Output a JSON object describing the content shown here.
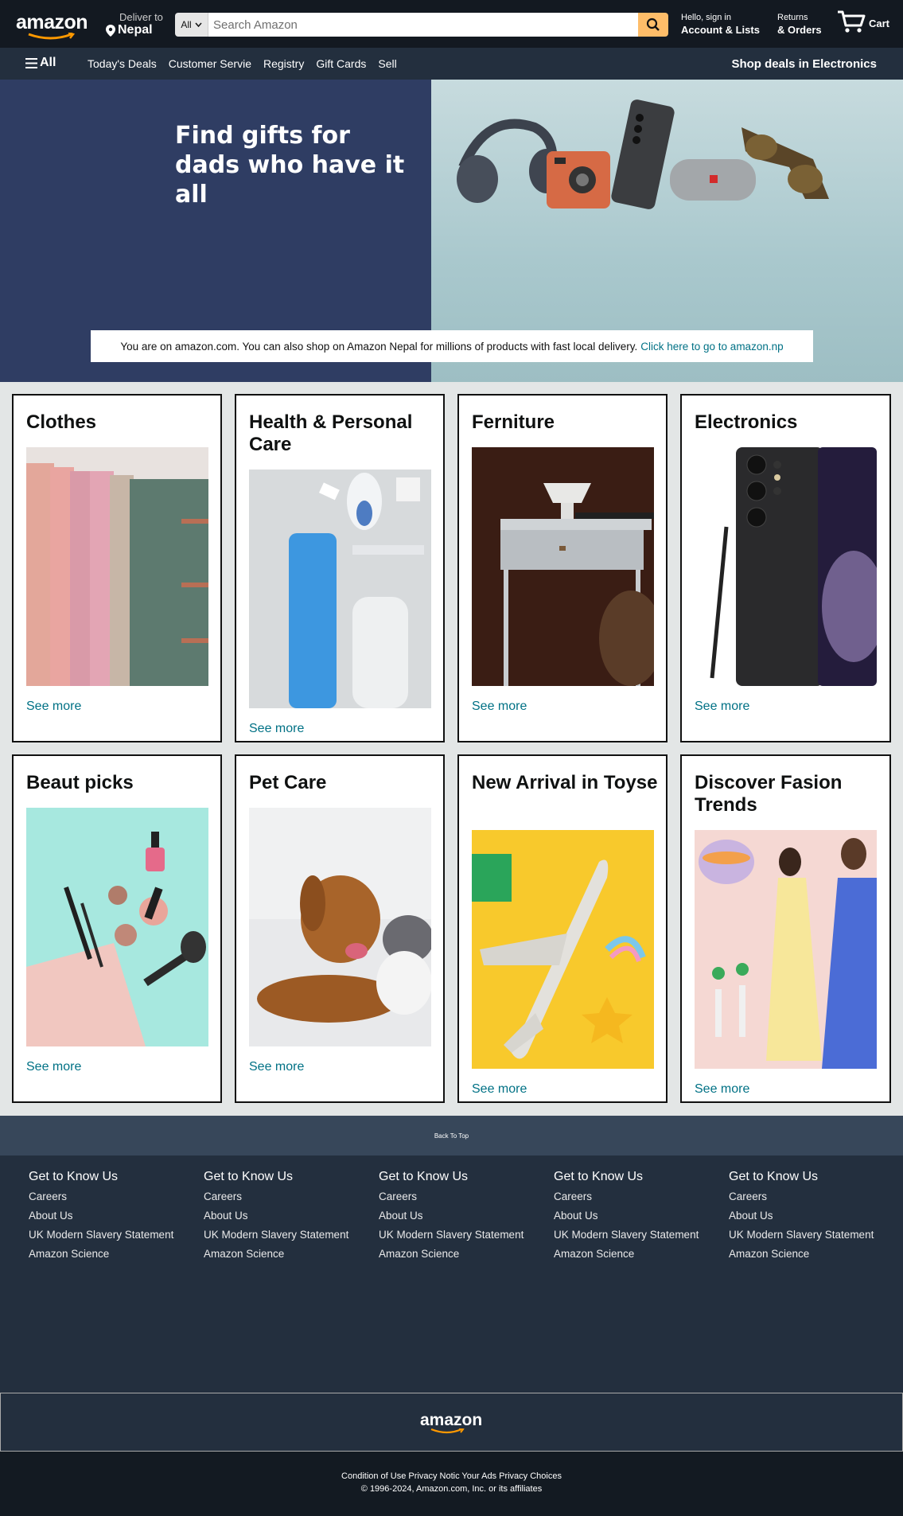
{
  "header": {
    "logo": "amazon",
    "deliver_label": "Deliver to",
    "deliver_location": "Nepal",
    "search_category": "All",
    "search_placeholder": "Search Amazon",
    "account_line1": "Hello, sign in",
    "account_line2": "Account & Lists",
    "returns_line1": "Returns",
    "returns_line2": "& Orders",
    "cart_label": "Cart",
    "colors": {
      "nav_bg": "#131921",
      "subnav_bg": "#232f3e",
      "search_button": "#febd69",
      "accent": "#febd69"
    }
  },
  "subnav": {
    "all_label": "All",
    "links": [
      "Today's Deals",
      "Customer Servie",
      "Registry",
      "Gift Cards",
      "Sell"
    ],
    "promo": "Shop deals in Electronics"
  },
  "hero": {
    "title": "Find gifts for dads who have it all",
    "notice_text": "You are on amazon.com. You can also shop on Amazon Nepal for millions of products with fast local delivery.",
    "notice_link": "Click here to go to amazon.np"
  },
  "cards": [
    {
      "title": "Clothes",
      "more": "See more",
      "image_icon": "clothes-image"
    },
    {
      "title": "Health & Personal Care",
      "more": "See more",
      "image_icon": "health-image"
    },
    {
      "title": "Ferniture",
      "more": "See more",
      "image_icon": "furniture-image"
    },
    {
      "title": "Electronics",
      "more": "See more",
      "image_icon": "phone-image"
    },
    {
      "title": "Beaut picks",
      "more": "See more",
      "image_icon": "makeup-image"
    },
    {
      "title": "Pet Care",
      "more": "See more",
      "image_icon": "pets-image"
    },
    {
      "title": "New Arrival in Toyse",
      "more": "See more",
      "image_icon": "toy-plane-image"
    },
    {
      "title": "Discover Fasion Trends",
      "more": "See more",
      "image_icon": "fashion-image"
    }
  ],
  "footer": {
    "back_to_top": "Back To Top",
    "columns": [
      {
        "heading": "Get to Know Us",
        "links": [
          "Careers",
          "About Us",
          "UK Modern Slavery Statement",
          "Amazon Science"
        ]
      },
      {
        "heading": "Get to Know Us",
        "links": [
          "Careers",
          "About Us",
          "UK Modern Slavery Statement",
          "Amazon Science"
        ]
      },
      {
        "heading": "Get to Know Us",
        "links": [
          "Careers",
          "About Us",
          "UK Modern Slavery Statement",
          "Amazon Science"
        ]
      },
      {
        "heading": "Get to Know Us",
        "links": [
          "Careers",
          "About Us",
          "UK Modern Slavery Statement",
          "Amazon Science"
        ]
      },
      {
        "heading": "Get to Know Us",
        "links": [
          "Careers",
          "About Us",
          "UK Modern Slavery Statement",
          "Amazon Science"
        ]
      }
    ],
    "logo": "amazon",
    "legal_links": "Condition of Use Privacy Notic Your Ads Privacy Choices",
    "copyright": "© 1996-2024, Amazon.com, Inc. or its affiliates"
  }
}
